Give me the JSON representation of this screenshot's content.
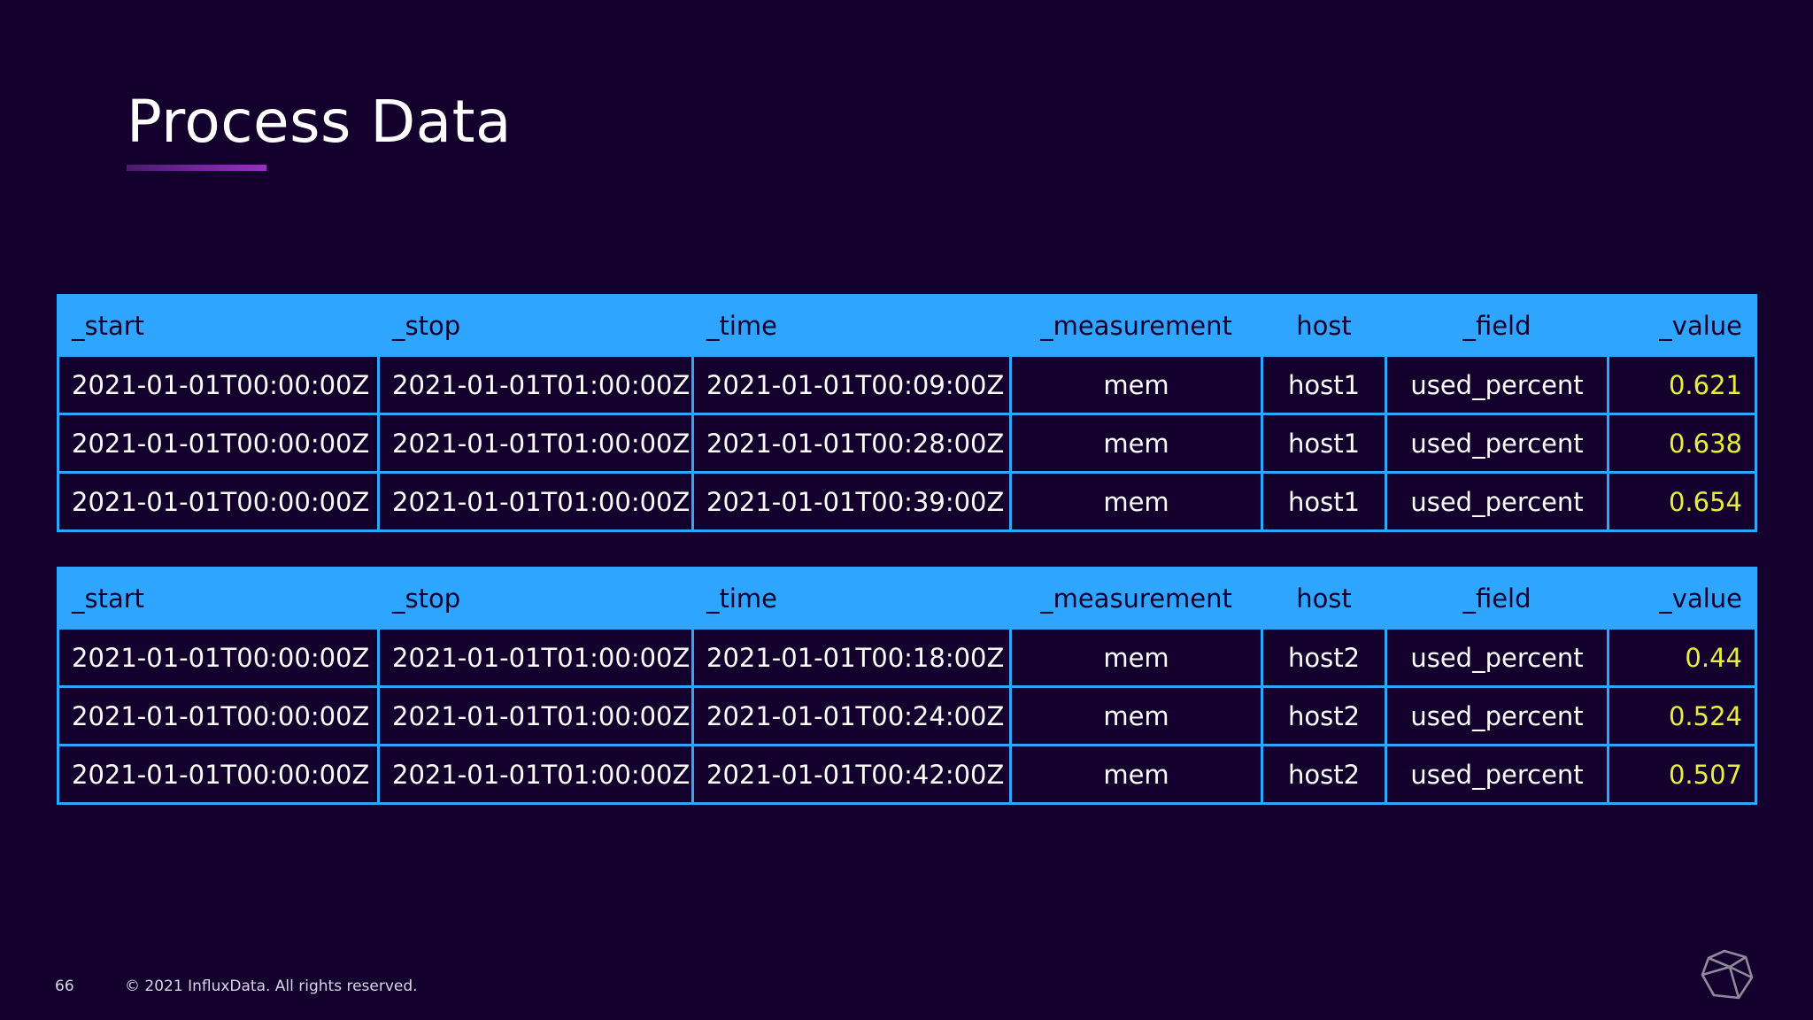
{
  "title": "Process Data",
  "colors": {
    "background": "#13002d",
    "header": "#2ea6ff",
    "value_text": "#e8ef3a",
    "accent_underline": "#9b2fc7"
  },
  "tables": [
    {
      "headers": [
        "_start",
        "_stop",
        "_time",
        "_measurement",
        "host",
        "_field",
        "_value"
      ],
      "rows": [
        [
          "2021-01-01T00:00:00Z",
          "2021-01-01T01:00:00Z",
          "2021-01-01T00:09:00Z",
          "mem",
          "host1",
          "used_percent",
          "0.621"
        ],
        [
          "2021-01-01T00:00:00Z",
          "2021-01-01T01:00:00Z",
          "2021-01-01T00:28:00Z",
          "mem",
          "host1",
          "used_percent",
          "0.638"
        ],
        [
          "2021-01-01T00:00:00Z",
          "2021-01-01T01:00:00Z",
          "2021-01-01T00:39:00Z",
          "mem",
          "host1",
          "used_percent",
          "0.654"
        ]
      ]
    },
    {
      "headers": [
        "_start",
        "_stop",
        "_time",
        "_measurement",
        "host",
        "_field",
        "_value"
      ],
      "rows": [
        [
          "2021-01-01T00:00:00Z",
          "2021-01-01T01:00:00Z",
          "2021-01-01T00:18:00Z",
          "mem",
          "host2",
          "used_percent",
          "0.44"
        ],
        [
          "2021-01-01T00:00:00Z",
          "2021-01-01T01:00:00Z",
          "2021-01-01T00:24:00Z",
          "mem",
          "host2",
          "used_percent",
          "0.524"
        ],
        [
          "2021-01-01T00:00:00Z",
          "2021-01-01T01:00:00Z",
          "2021-01-01T00:42:00Z",
          "mem",
          "host2",
          "used_percent",
          "0.507"
        ]
      ]
    }
  ],
  "footer": {
    "page_number": "66",
    "copyright": "© 2021 InfluxData. All rights reserved."
  },
  "logo_icon": "influxdata-cube-icon"
}
